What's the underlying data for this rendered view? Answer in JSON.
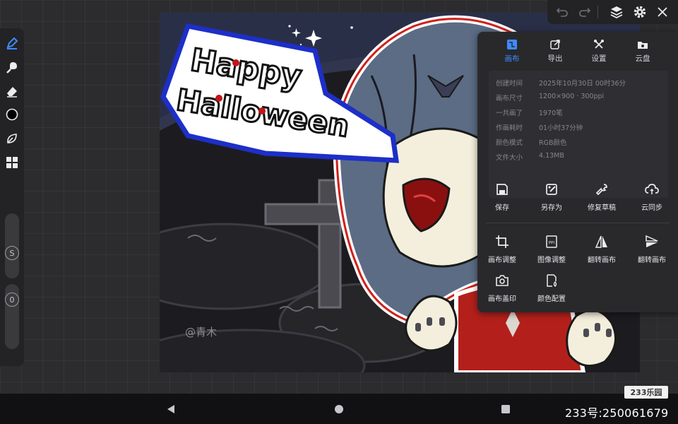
{
  "canvas": {
    "title_line1": "Happy",
    "title_line2": "Halloween",
    "watermark": "@青木"
  },
  "left_toolbar": {
    "tools": [
      "pen-tool-icon",
      "smudge-brush-icon",
      "eraser-icon",
      "color-picker-icon",
      "leaf-brush-icon",
      "layers-grid-icon"
    ],
    "active_tool": "pen-tool-icon",
    "size_slider_label": "S",
    "opacity_slider_label": "0"
  },
  "top_toolbar": {
    "icons": [
      "undo-icon",
      "redo-icon",
      "layers-icon",
      "gear-icon",
      "close-icon"
    ]
  },
  "panel": {
    "tabs": [
      {
        "label": "画布",
        "icon": "canvas-tab-icon",
        "active": true
      },
      {
        "label": "导出",
        "icon": "export-icon",
        "active": false
      },
      {
        "label": "设置",
        "icon": "settings-tools-icon",
        "active": false
      },
      {
        "label": "云盘",
        "icon": "cloud-folder-icon",
        "active": false
      }
    ],
    "info": [
      {
        "key": "创建时间",
        "value": "2025年10月30日 00时36分"
      },
      {
        "key": "画布尺寸",
        "value": "1200×900 · 300ppi"
      },
      {
        "key": "一共画了",
        "value": "1970笔"
      },
      {
        "key": "作画耗时",
        "value": "01小时37分钟"
      },
      {
        "key": "颜色模式",
        "value": "RGB颜色"
      },
      {
        "key": "文件大小",
        "value": "4.13MB"
      }
    ],
    "actions_row1": [
      {
        "label": "保存",
        "icon": "save-icon"
      },
      {
        "label": "另存为",
        "icon": "save-as-icon"
      },
      {
        "label": "修复草稿",
        "icon": "wrench-icon"
      },
      {
        "label": "云同步",
        "icon": "cloud-sync-icon"
      }
    ],
    "actions_row2": [
      {
        "label": "画布调整",
        "icon": "crop-icon"
      },
      {
        "label": "图像调整",
        "icon": "ppi-icon"
      },
      {
        "label": "翻转画布",
        "icon": "flip-horizontal-icon"
      },
      {
        "label": "翻转画布",
        "icon": "flip-vertical-icon"
      }
    ],
    "actions_row3": [
      {
        "label": "画布盖印",
        "icon": "camera-icon"
      },
      {
        "label": "颜色配置",
        "icon": "color-config-icon"
      }
    ]
  },
  "navbar": {
    "icons": [
      "back-icon",
      "home-icon",
      "recents-icon"
    ]
  },
  "overlay": {
    "brand": "233乐园",
    "account_id": "233号:250061679"
  }
}
